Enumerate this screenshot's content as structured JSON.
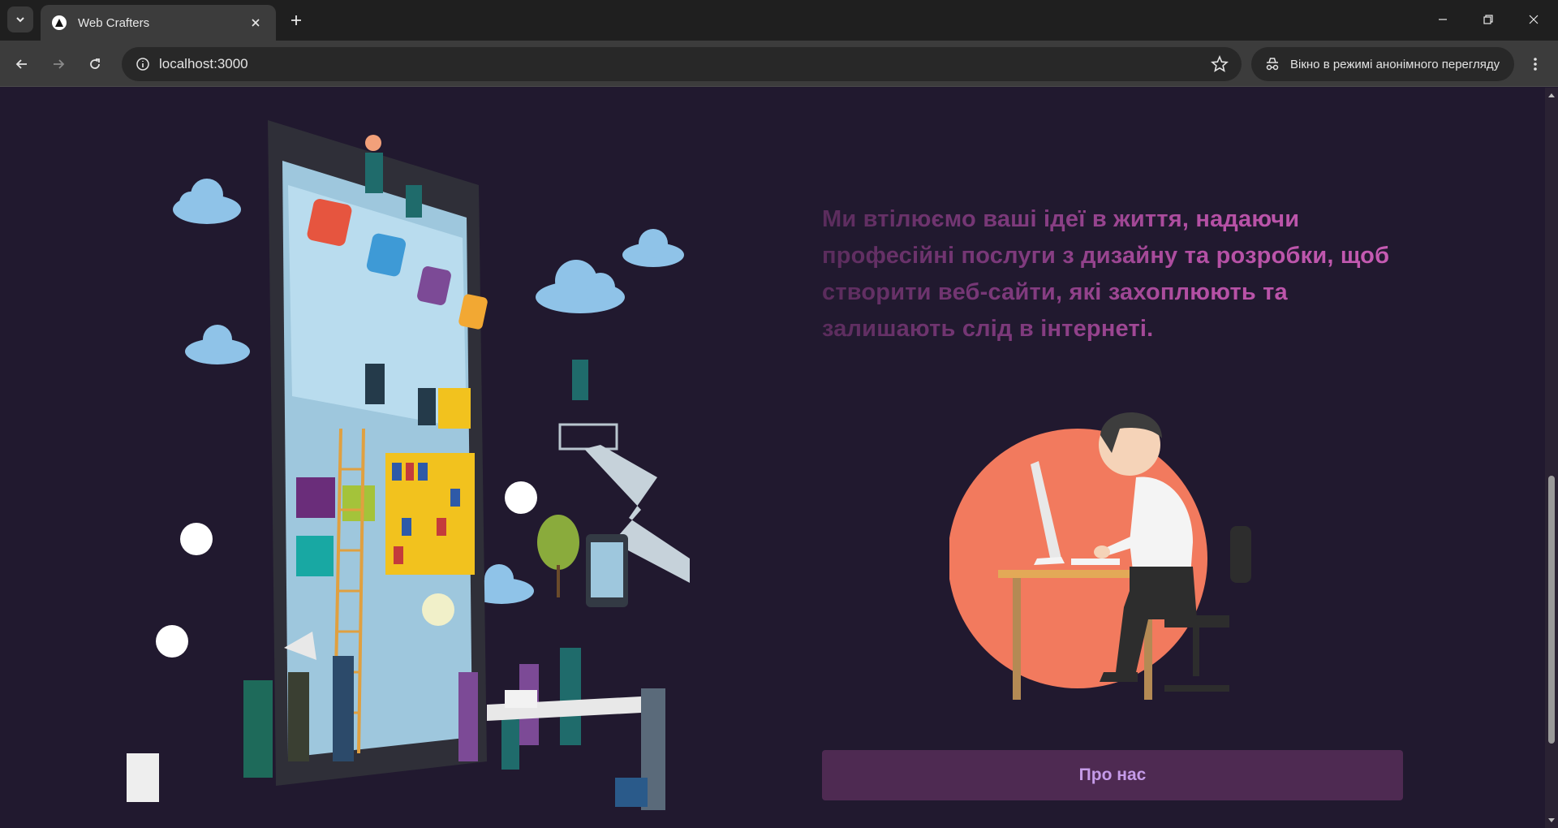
{
  "browser": {
    "tab_title": "Web Crafters",
    "url": "localhost:3000",
    "incognito_label": "Вікно в режимі анонімного перегляду"
  },
  "hero": {
    "text": "Ми втілюємо ваші ідеї в життя, надаючи професійні послуги з дизайну та розробки, щоб створити веб-сайти, які захоплюють та залишають слід в інтернеті.",
    "button_label": "Про нас"
  },
  "colors": {
    "page_bg": "#21192f",
    "button_bg": "#4e2a52",
    "button_text": "#c59be8",
    "text_gradient_start": "#5a2c5c",
    "text_gradient_end": "#c65bb3",
    "circle": "#f27a5e"
  },
  "icons": [
    "tab-list-icon",
    "close-icon",
    "plus-icon",
    "minimize-icon",
    "restore-icon",
    "back-icon",
    "forward-icon",
    "reload-icon",
    "site-info-icon",
    "star-icon",
    "incognito-icon",
    "kebab-menu-icon"
  ]
}
